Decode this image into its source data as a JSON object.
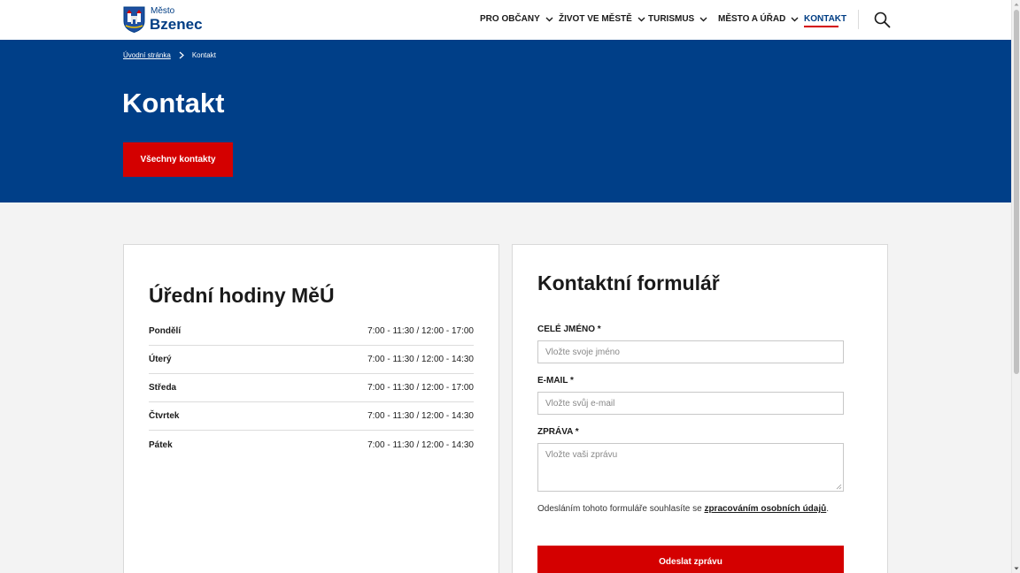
{
  "header": {
    "logo_small": "Město",
    "logo_big": "Bzenec",
    "nav": [
      {
        "label": "PRO OBČANY",
        "has_dropdown": true
      },
      {
        "label": "ŽIVOT VE MĚSTĚ",
        "has_dropdown": true
      },
      {
        "label": "TURISMUS",
        "has_dropdown": true
      },
      {
        "label": "MĚSTO A ÚŘAD",
        "has_dropdown": true
      },
      {
        "label": "KONTAKT",
        "has_dropdown": false,
        "active": true
      }
    ],
    "search_icon": "search-icon"
  },
  "hero": {
    "breadcrumb_home": "Úvodní stránka",
    "breadcrumb_current": "Kontakt",
    "title": "Kontakt",
    "button_label": "Všechny kontakty"
  },
  "hours": {
    "title": "Úřední hodiny MěÚ",
    "rows": [
      {
        "day": "Pondělí",
        "time": "7:00 - 11:30 / 12:00 - 17:00"
      },
      {
        "day": "Úterý",
        "time": "7:00 - 11:30 / 12:00 - 14:30"
      },
      {
        "day": "Středa",
        "time": "7:00 - 11:30 / 12:00 - 17:00"
      },
      {
        "day": "Čtvrtek",
        "time": "7:00 - 11:30 / 12:00 - 14:30"
      },
      {
        "day": "Pátek",
        "time": "7:00 - 11:30 / 12:00 - 14:30"
      }
    ]
  },
  "form": {
    "title": "Kontaktní formulář",
    "name_label": "CELÉ JMÉNO *",
    "name_placeholder": "Vložte svoje jméno",
    "email_label": "E-MAIL *",
    "email_placeholder": "Vložte svůj e-mail",
    "message_label": "ZPRÁVA *",
    "message_placeholder": "Vložte vaši zprávu",
    "consent_text": "Odesláním tohoto formuláře souhlasíte se ",
    "consent_link": "zpracováním osobních údajů",
    "consent_end": ".",
    "submit_label": "Odeslat zprávu"
  },
  "colors": {
    "brand_blue": "#003f88",
    "accent_red": "#d40000"
  }
}
